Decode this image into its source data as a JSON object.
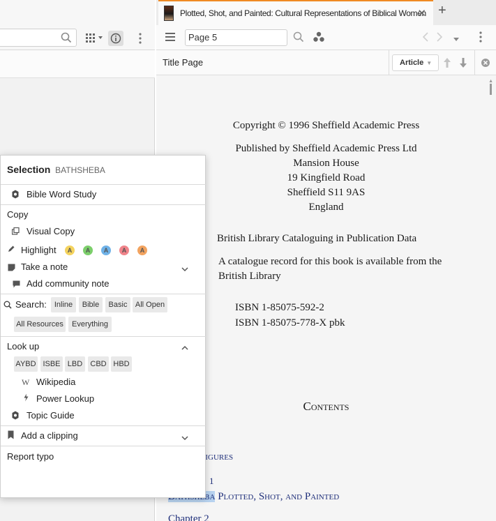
{
  "tab": {
    "title": "Plotted, Shot, and Painted: Cultural Representations of Biblical Women",
    "close_glyph": "✕",
    "new_tab_glyph": "+"
  },
  "toolbar": {
    "page_value": "Page 5"
  },
  "header": {
    "section_label": "Title Page",
    "article_label": "Article"
  },
  "document": {
    "copyright": "Copyright © 1996 Sheffield Academic Press",
    "publisher_lines": [
      "Published by Sheffield Academic Press Ltd",
      "Mansion House",
      "19 Kingfield Road",
      "Sheffield S11 9AS",
      "England"
    ],
    "cataloguing_heading": "British Library Cataloguing in Publication Data",
    "catalogue_record": [
      "A catalogue record for this book is available from the",
      "British Library"
    ],
    "isbn_lines": [
      "ISBN 1-85075-592-2",
      "ISBN 1-85075-778-X pbk"
    ],
    "contents_heading": "Contents",
    "toc_figures": "Figures",
    "toc_chapter1": "1",
    "toc_bathsheba": "Bathsheba",
    "toc_rest": " Plotted, Shot, and Painted",
    "toc_chapter2": "Chapter 2"
  },
  "popup": {
    "selection_label": "Selection",
    "selection_word": "BATHSHEBA",
    "bible_word_study": "Bible Word Study",
    "copy_heading": "Copy",
    "visual_copy": "Visual Copy",
    "highlight": "Highlight",
    "highlight_letters": [
      "A",
      "A",
      "A",
      "A",
      "A"
    ],
    "highlight_colors": [
      "#f4d35e",
      "#7ccf6b",
      "#6fb2e8",
      "#f0838a",
      "#f2a35f"
    ],
    "take_note": "Take a note",
    "community_note": "Add community note",
    "search_label": "Search:",
    "search_chips": [
      "Inline",
      "Bible",
      "Basic",
      "All Open",
      "All Resources",
      "Everything"
    ],
    "lookup_heading": "Look up",
    "lookup_chips": [
      "AYBD",
      "ISBE",
      "LBD",
      "CBD",
      "HBD"
    ],
    "wikipedia": "Wikipedia",
    "power_lookup": "Power Lookup",
    "topic_guide": "Topic Guide",
    "add_clipping": "Add a clipping",
    "report_typo": "Report typo"
  }
}
